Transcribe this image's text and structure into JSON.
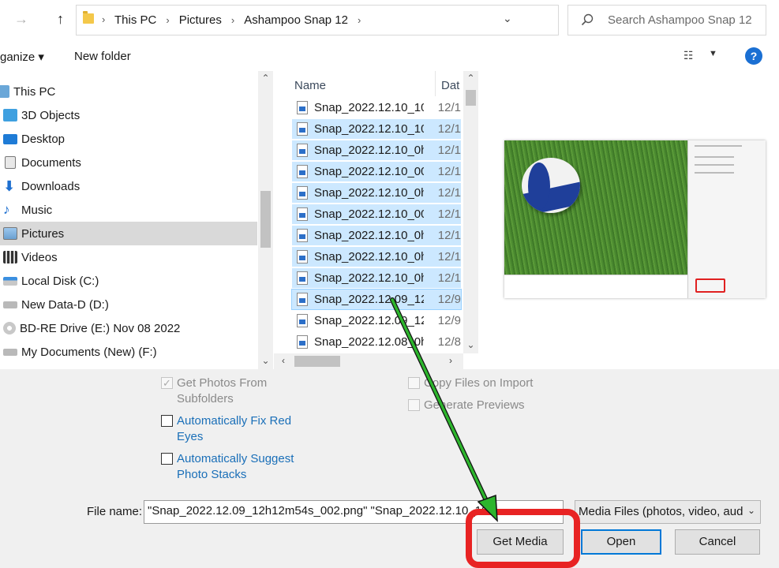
{
  "address_bar": {
    "breadcrumbs": [
      "This PC",
      "Pictures",
      "Ashampoo Snap 12"
    ],
    "search_placeholder": "Search Ashampoo Snap 12"
  },
  "toolbar": {
    "organize_label": "ganize ▾",
    "new_folder_label": "New folder",
    "help_label": "?"
  },
  "nav": {
    "items": [
      {
        "label": "This PC",
        "icon": "pc-icon"
      },
      {
        "label": "3D Objects",
        "icon": "cube-icon"
      },
      {
        "label": "Desktop",
        "icon": "desktop-icon"
      },
      {
        "label": "Documents",
        "icon": "documents-icon"
      },
      {
        "label": "Downloads",
        "icon": "download-icon"
      },
      {
        "label": "Music",
        "icon": "music-icon"
      },
      {
        "label": "Pictures",
        "icon": "pictures-icon",
        "selected": true
      },
      {
        "label": "Videos",
        "icon": "videos-icon"
      },
      {
        "label": "Local Disk (C:)",
        "icon": "drive-icon"
      },
      {
        "label": "New Data-D (D:)",
        "icon": "drive-icon"
      },
      {
        "label": "BD-RE Drive (E:) Nov 08 2022",
        "icon": "disc-icon"
      },
      {
        "label": "My Documents (New) (F:)",
        "icon": "drive-icon"
      }
    ]
  },
  "file_list": {
    "columns": [
      "Name",
      "Dat"
    ],
    "rows": [
      {
        "name": "Snap_2022.12.10_10...",
        "date": "12/1",
        "state": "none"
      },
      {
        "name": "Snap_2022.12.10_10...",
        "date": "12/1",
        "state": "selected"
      },
      {
        "name": "Snap_2022.12.10_0h...",
        "date": "12/1",
        "state": "selected"
      },
      {
        "name": "Snap_2022.12.10_00...",
        "date": "12/1",
        "state": "selected"
      },
      {
        "name": "Snap_2022.12.10_0h...",
        "date": "12/1",
        "state": "selected"
      },
      {
        "name": "Snap_2022.12.10_00...",
        "date": "12/1",
        "state": "selected"
      },
      {
        "name": "Snap_2022.12.10_0h...",
        "date": "12/1",
        "state": "selected"
      },
      {
        "name": "Snap_2022.12.10_0h...",
        "date": "12/1",
        "state": "selected"
      },
      {
        "name": "Snap_2022.12.10_0h...",
        "date": "12/1",
        "state": "selected"
      },
      {
        "name": "Snap_2022.12.09_12...",
        "date": "12/9",
        "state": "focused"
      },
      {
        "name": "Snap_2022.12.09_12...",
        "date": "12/9",
        "state": "none"
      },
      {
        "name": "Snap_2022.12.08_0h...",
        "date": "12/8",
        "state": "none"
      }
    ]
  },
  "options": {
    "get_photos_subfolders": "Get Photos From Subfolders",
    "auto_fix_red_eyes": "Automatically Fix Red Eyes",
    "auto_suggest_stacks": "Automatically Suggest Photo Stacks",
    "copy_files_on_import": "Copy Files on Import",
    "generate_previews": "Generate Previews"
  },
  "file_name": {
    "label": "File name:",
    "value": "\"Snap_2022.12.09_12h12m54s_002.png\" \"Snap_2022.12.10_10h"
  },
  "file_type": {
    "selected": "Media Files (photos, video, aud"
  },
  "buttons": {
    "get_media": "Get Media",
    "open": "Open",
    "cancel": "Cancel"
  },
  "colors": {
    "selection": "#cce8ff",
    "accent": "#0078d7",
    "annotation_red": "#e82323",
    "annotation_arrow": "#2db52d"
  }
}
